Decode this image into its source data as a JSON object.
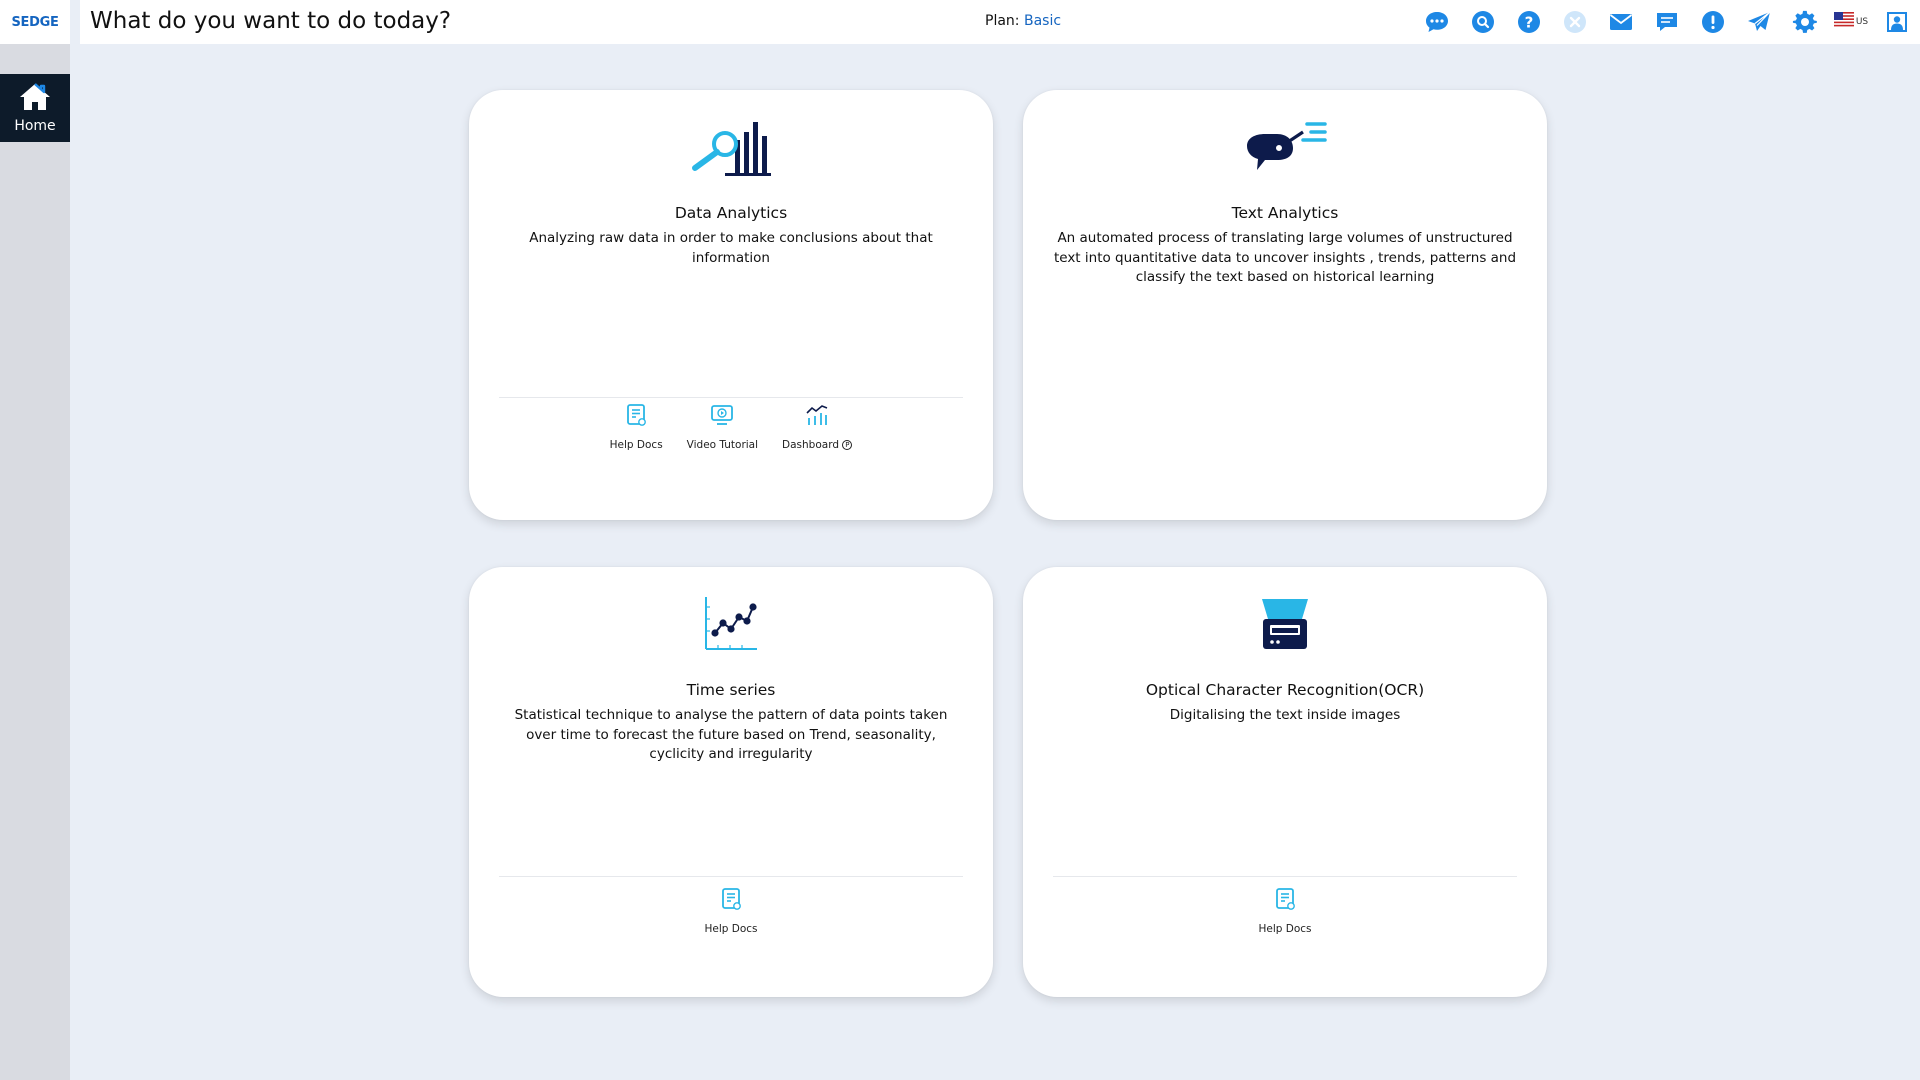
{
  "app": {
    "logo_text": "SEDGE",
    "page_title": "What do you want to do today?",
    "plan_label": "Plan:",
    "plan_value": "Basic"
  },
  "sidebar": {
    "items": [
      {
        "label": "Home",
        "icon": "home-icon",
        "active": true
      }
    ]
  },
  "header_icons": [
    {
      "name": "chat-icon"
    },
    {
      "name": "search-icon"
    },
    {
      "name": "help-icon"
    },
    {
      "name": "close-icon"
    },
    {
      "name": "mail-icon"
    },
    {
      "name": "messages-icon"
    },
    {
      "name": "alert-icon"
    },
    {
      "name": "send-icon"
    },
    {
      "name": "settings-icon"
    }
  ],
  "locale": {
    "flag": "us-flag-icon",
    "code": "US"
  },
  "colors": {
    "accent": "#1e88e5",
    "brand_dark": "#0d1b2a",
    "icon_cyan": "#29b6e6",
    "icon_navy": "#0d1b4b",
    "background": "#e9eef6"
  },
  "cards": [
    {
      "title": "Data Analytics",
      "description": "Analyzing raw data in order to make conclusions about that information",
      "icon": "data-analytics-icon",
      "actions": [
        {
          "label": "Help Docs",
          "icon": "help-docs-icon"
        },
        {
          "label": "Video Tutorial",
          "icon": "video-tutorial-icon"
        },
        {
          "label": "Dashboard",
          "icon": "dashboard-icon",
          "badge": "P"
        }
      ]
    },
    {
      "title": "Text Analytics",
      "description": "An automated process of translating large volumes of unstructured text into quantitative data to uncover insights , trends, patterns and classify the text based on historical learning",
      "icon": "text-analytics-icon",
      "actions": []
    },
    {
      "title": "Time series",
      "description": "Statistical technique to analyse the pattern of data points taken over time to forecast the future based on Trend, seasonality, cyclicity and irregularity",
      "icon": "time-series-icon",
      "actions": [
        {
          "label": "Help Docs",
          "icon": "help-docs-icon"
        }
      ]
    },
    {
      "title": "Optical Character Recognition(OCR)",
      "description": "Digitalising the text inside images",
      "icon": "ocr-scanner-icon",
      "actions": [
        {
          "label": "Help Docs",
          "icon": "help-docs-icon"
        }
      ]
    }
  ]
}
